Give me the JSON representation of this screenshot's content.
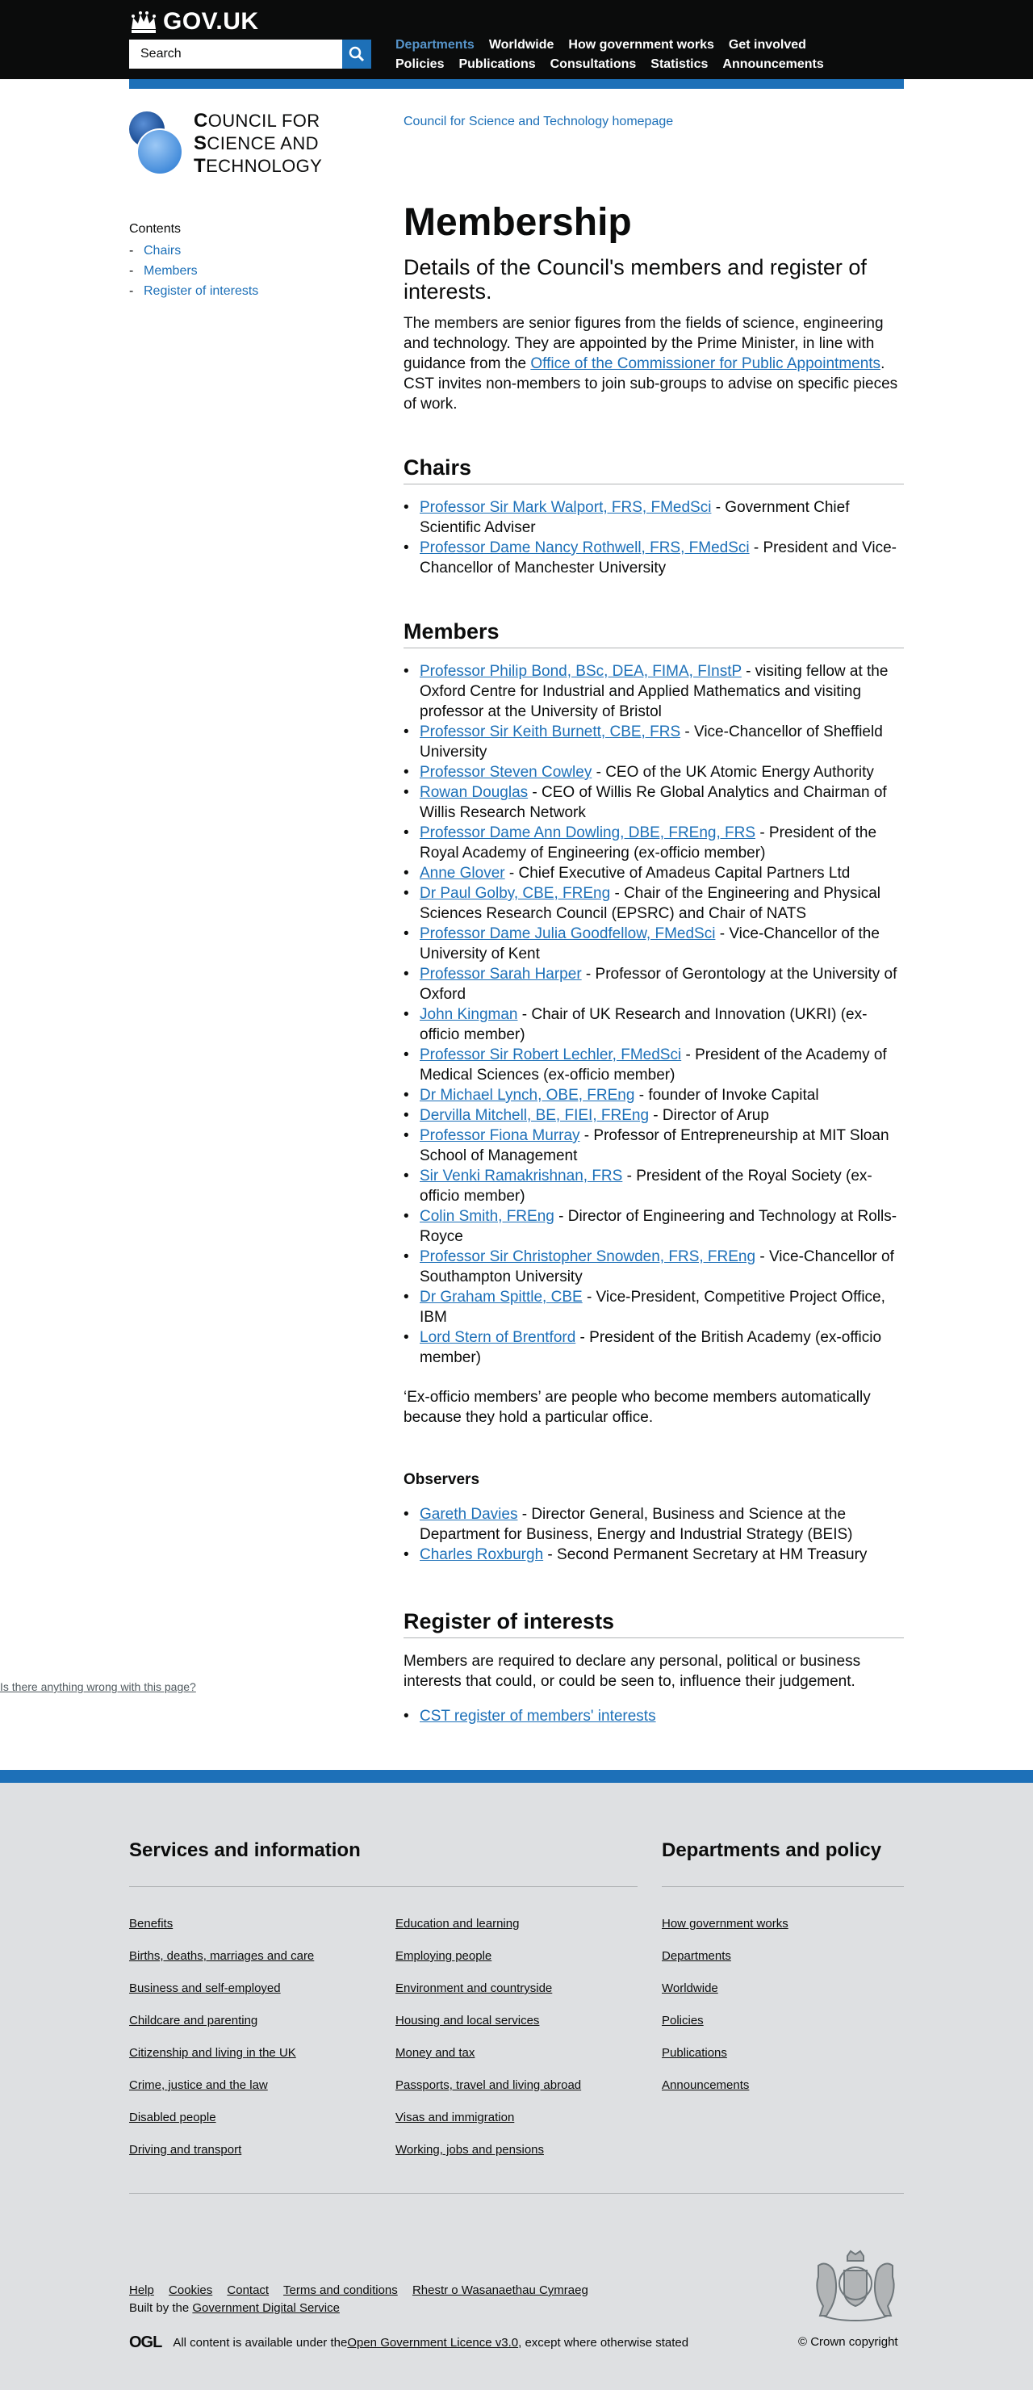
{
  "header": {
    "logo_text": "GOV.UK",
    "search_placeholder": "Search",
    "nav_row1": [
      "Departments",
      "Worldwide",
      "How government works",
      "Get involved"
    ],
    "nav_row2": [
      "Policies",
      "Publications",
      "Consultations",
      "Statistics",
      "Announcements"
    ]
  },
  "org": {
    "name_lines": [
      {
        "initial": "C",
        "rest": "OUNCIL FOR"
      },
      {
        "initial": "S",
        "rest": "CIENCE AND"
      },
      {
        "initial": "T",
        "rest": "ECHNOLOGY"
      }
    ],
    "homepage_link": "Council for Science and Technology homepage"
  },
  "contents": {
    "title": "Contents",
    "items": [
      "Chairs",
      "Members",
      "Register of interests"
    ]
  },
  "page": {
    "title": "Membership",
    "lead": "Details of the Council's members and register of interests.",
    "intro": {
      "before": "The members are senior figures from the fields of science, engineering and technology. They are appointed by the Prime Minister, in line with guidance from the ",
      "link": "Office of the Commissioner for Public Appointments",
      "after": ". CST invites non-members to join sub-groups to advise on specific pieces of work."
    }
  },
  "chairs": {
    "heading": "Chairs",
    "items": [
      {
        "name": "Professor Sir Mark Walport, FRS, FMedSci",
        "role": " - Government Chief Scientific Adviser"
      },
      {
        "name": "Professor Dame Nancy Rothwell, FRS, FMedSci",
        "role": " - President and Vice-Chancellor of Manchester University"
      }
    ]
  },
  "members": {
    "heading": "Members",
    "items": [
      {
        "name": "Professor Philip Bond, BSc, DEA, FIMA, FInstP",
        "role": " - visiting fellow at the Oxford Centre for Industrial and Applied Mathematics and visiting professor at the University of Bristol"
      },
      {
        "name": "Professor Sir Keith Burnett, CBE, FRS",
        "role": " - Vice-Chancellor of Sheffield University"
      },
      {
        "name": "Professor Steven Cowley",
        "role": " - CEO of the UK Atomic Energy Authority"
      },
      {
        "name": "Rowan Douglas",
        "role": " - CEO of Willis Re Global Analytics and Chairman of Willis Research Network"
      },
      {
        "name": "Professor Dame Ann Dowling, DBE, FREng, FRS",
        "role": " - President of the Royal Academy of Engineering (ex-officio member)"
      },
      {
        "name": "Anne Glover",
        "role": " - Chief Executive of Amadeus Capital Partners Ltd"
      },
      {
        "name": "Dr Paul Golby, CBE, FREng",
        "role": " - Chair of the Engineering and Physical Sciences Research Council (EPSRC) and Chair of NATS"
      },
      {
        "name": "Professor Dame Julia Goodfellow, FMedSci",
        "role": " - Vice-Chancellor of the University of Kent"
      },
      {
        "name": "Professor Sarah Harper",
        "role": " - Professor of Gerontology at the University of Oxford"
      },
      {
        "name": "John Kingman",
        "role": " - Chair of UK Research and Innovation (UKRI) (ex-officio member)"
      },
      {
        "name": "Professor Sir Robert Lechler, FMedSci",
        "role": " - President of the Academy of Medical Sciences (ex-officio member)"
      },
      {
        "name": "Dr Michael Lynch, OBE, FREng",
        "role": " - founder of Invoke Capital"
      },
      {
        "name": "Dervilla Mitchell, BE, FIEI, FREng",
        "role": " - Director of Arup"
      },
      {
        "name": "Professor Fiona Murray",
        "role": " - Professor of Entrepreneurship at MIT Sloan School of Management"
      },
      {
        "name": "Sir Venki Ramakrishnan, FRS",
        "role": " - President of the Royal Society (ex-officio member)"
      },
      {
        "name": "Colin Smith, FREng",
        "role": " - Director of Engineering and Technology at Rolls-Royce"
      },
      {
        "name": "Professor Sir Christopher Snowden, FRS, FREng",
        "role": " - Vice-Chancellor of Southampton University"
      },
      {
        "name": "Dr Graham Spittle, CBE",
        "role": " - Vice-President, Competitive Project Office, IBM"
      },
      {
        "name": "Lord Stern of Brentford",
        "role": " - President of the British Academy (ex-officio member)"
      }
    ],
    "note": "‘Ex-officio members’ are people who become members automatically because they hold a particular office."
  },
  "observers": {
    "heading": "Observers",
    "items": [
      {
        "name": "Gareth Davies",
        "role": " - Director General, Business and Science at the Department for Business, Energy and Industrial Strategy (BEIS)"
      },
      {
        "name": "Charles Roxburgh",
        "role": " - Second Permanent Secretary at HM Treasury"
      }
    ]
  },
  "register": {
    "heading": "Register of interests",
    "text": "Members are required to declare any personal, political or business interests that could, or could be seen to, influence their judgement.",
    "link": "CST register of members' interests"
  },
  "report_link": "Is there anything wrong with this page?",
  "footer": {
    "services_heading": "Services and information",
    "departments_heading": "Departments and policy",
    "services_col1": [
      "Benefits",
      "Births, deaths, marriages and care",
      "Business and self-employed",
      "Childcare and parenting",
      "Citizenship and living in the UK",
      "Crime, justice and the law",
      "Disabled people",
      "Driving and transport"
    ],
    "services_col2": [
      "Education and learning",
      "Employing people",
      "Environment and countryside",
      "Housing and local services",
      "Money and tax",
      "Passports, travel and living abroad",
      "Visas and immigration",
      "Working, jobs and pensions"
    ],
    "departments": [
      "How government works",
      "Departments",
      "Worldwide",
      "Policies",
      "Publications",
      "Announcements"
    ],
    "meta_links": [
      "Help",
      "Cookies",
      "Contact",
      "Terms and conditions",
      "Rhestr o Wasanaethau Cymraeg"
    ],
    "built_prefix": "Built by the ",
    "built_link": "Government Digital Service",
    "ogl": "OGL",
    "licence_prefix": "All content is available under the ",
    "licence_link": "Open Government Licence v3.0",
    "licence_suffix": ", except where otherwise stated",
    "copyright": "© Crown copyright"
  },
  "colors": {
    "header_bg": "#0b0c0c",
    "brand_blue": "#1d70b8",
    "active_nav": "#5694ca",
    "footer_bg": "#dee0e2"
  }
}
